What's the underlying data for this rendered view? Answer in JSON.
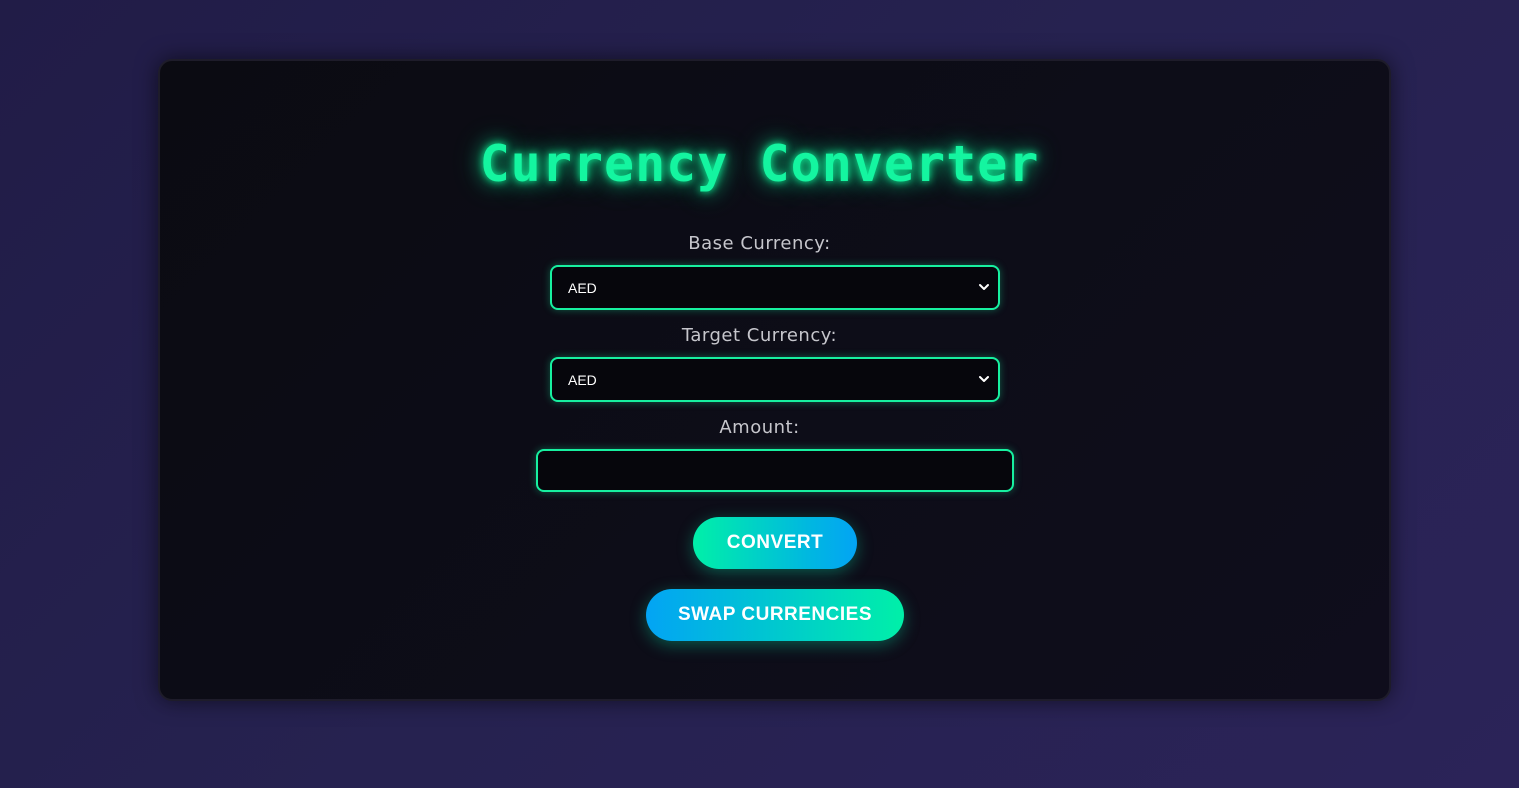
{
  "app": {
    "title": "Currency Converter"
  },
  "form": {
    "base_label": "Base Currency:",
    "base_value": "AED",
    "target_label": "Target Currency:",
    "target_value": "AED",
    "amount_label": "Amount:",
    "amount_value": ""
  },
  "buttons": {
    "convert": "CONVERT",
    "swap": "SWAP CURRENCIES"
  },
  "colors": {
    "accent": "#14f5a0",
    "secondary": "#03a4f4",
    "card_background": "#0b0b12",
    "page_background": "#262250"
  },
  "icons": {
    "select_chevron": "chevron-down-icon"
  }
}
